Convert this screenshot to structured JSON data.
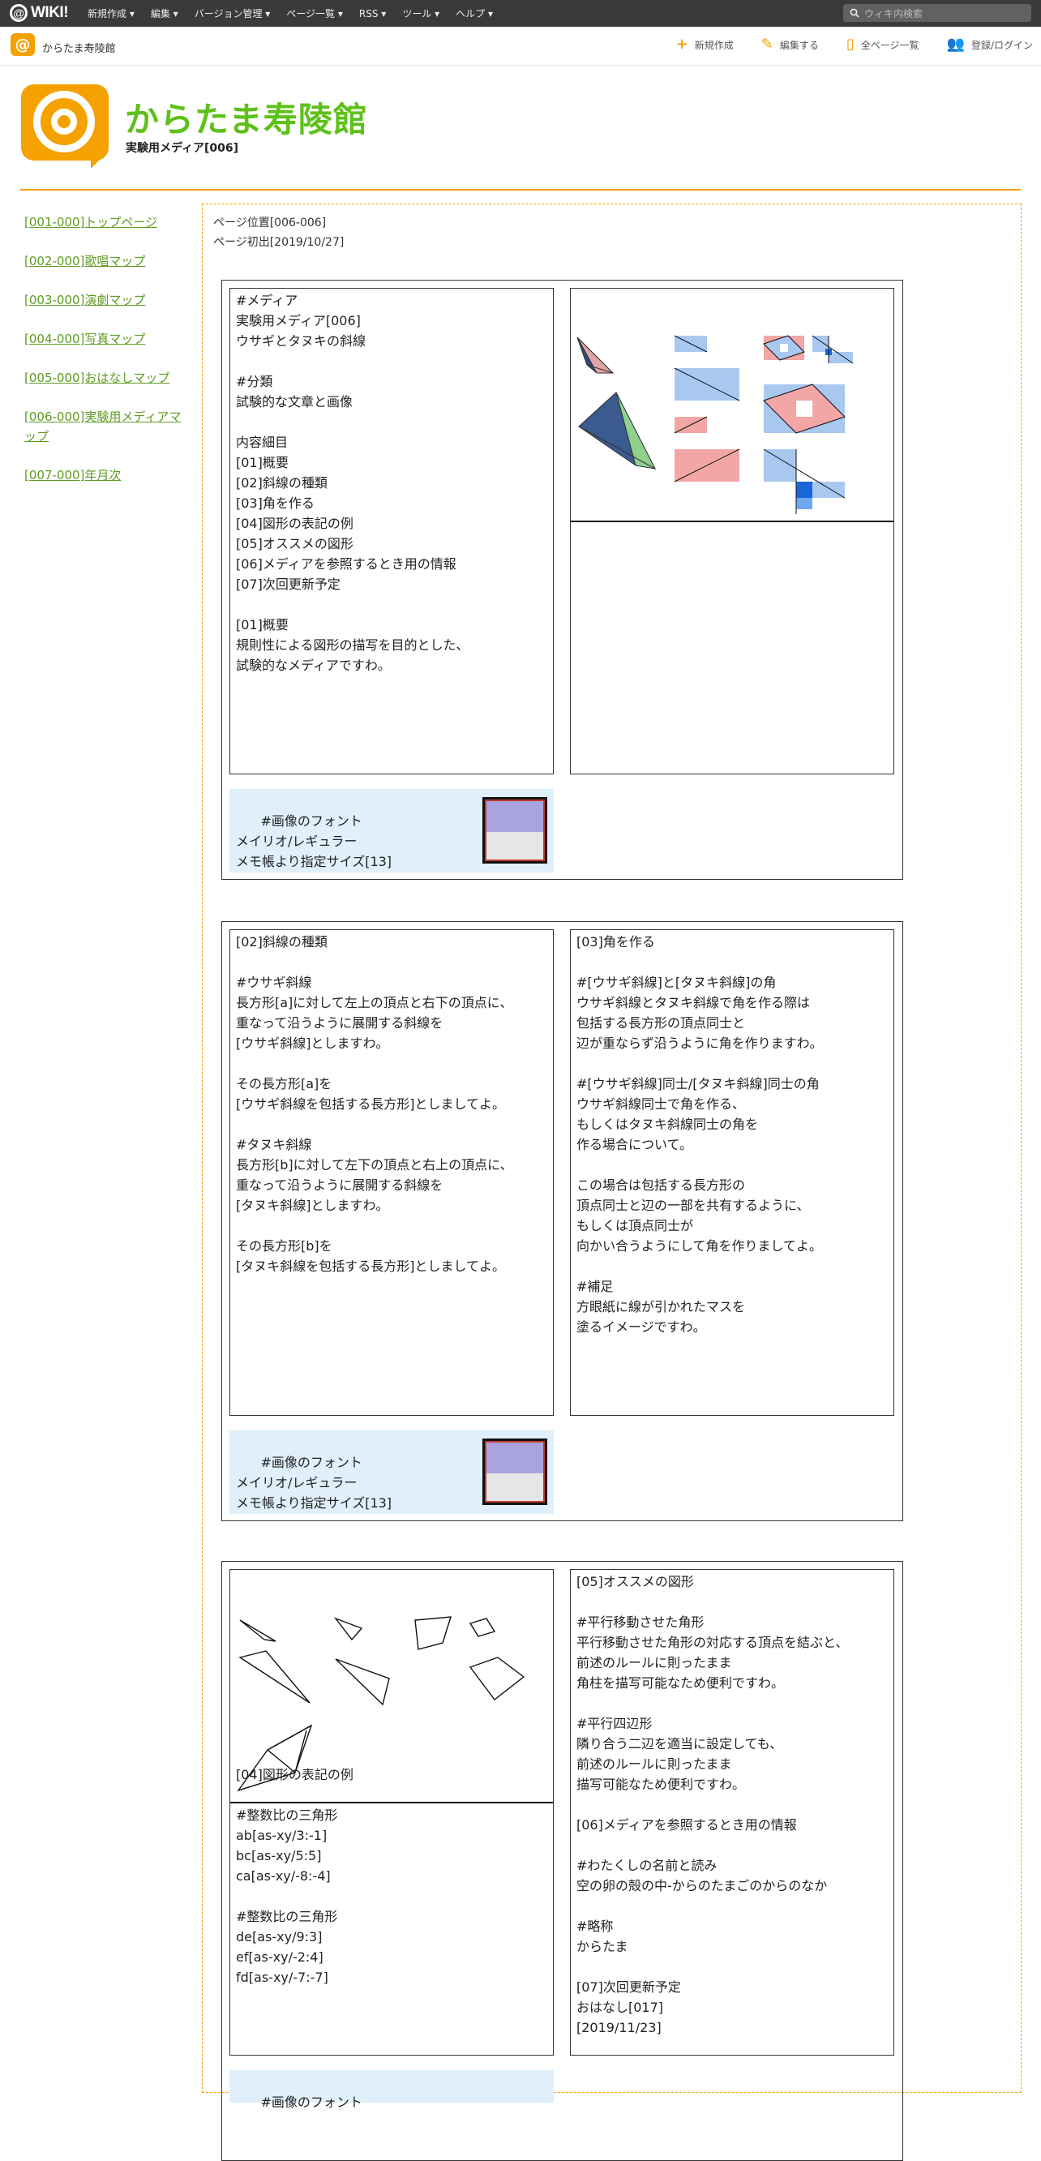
{
  "topbar": {
    "logo": "WIKI!",
    "menu": [
      "新規作成 ▾",
      "編集 ▾",
      "バージョン管理 ▾",
      "ページ一覧 ▾",
      "RSS ▾",
      "ツール ▾",
      "ヘルプ ▾"
    ],
    "search_placeholder": "ウィキ内検索"
  },
  "subbar": {
    "site_name": "からたま寿陵館",
    "actions": [
      "新規作成",
      "編集する",
      "全ページ一覧",
      "登録/ログイン"
    ]
  },
  "header": {
    "title": "からたま寿陵館",
    "subtitle": "実験用メディア[006]"
  },
  "sidebar": {
    "items": [
      "[001-000]トップページ",
      "[002-000]歌唱マップ",
      "[003-000]演劇マップ",
      "[004-000]写真マップ",
      "[005-000]おはなしマップ",
      "[006-000]実験用メディアマップ",
      "[007-000]年月次"
    ]
  },
  "main": {
    "page_position": "ページ位置[006-006]",
    "page_first": "ページ初出[2019/10/27]",
    "section1": {
      "text": "#メディア\n実験用メディア[006]\nウサギとタヌキの斜線\n\n#分類\n試験的な文章と画像\n\n内容細目\n[01]概要\n[02]斜線の種類\n[03]角を作る\n[04]図形の表記の例\n[05]オススメの図形\n[06]メディアを参照するとき用の情報\n[07]次回更新予定\n\n[01]概要\n規則性による図形の描写を目的とした、\n試験的なメディアですわ。",
      "font_info": "#画像のフォント\nメイリオ/レギュラー\nメモ帳より指定サイズ[13]"
    },
    "section2": {
      "left_text": "[02]斜線の種類\n\n#ウサギ斜線\n長方形[a]に対して左上の頂点と右下の頂点に、\n重なって沿うように展開する斜線を\n[ウサギ斜線]としますわ。\n\nその長方形[a]を\n[ウサギ斜線を包括する長方形]としましてよ。\n\n#タヌキ斜線\n長方形[b]に対して左下の頂点と右上の頂点に、\n重なって沿うように展開する斜線を\n[タヌキ斜線]としますわ。\n\nその長方形[b]を\n[タヌキ斜線を包括する長方形]としましてよ。",
      "right_text": "[03]角を作る\n\n#[ウサギ斜線]と[タヌキ斜線]の角\nウサギ斜線とタヌキ斜線で角を作る際は\n包括する長方形の頂点同士と\n辺が重ならず沿うように角を作りますわ。\n\n#[ウサギ斜線]同士/[タヌキ斜線]同士の角\nウサギ斜線同士で角を作る、\nもしくはタヌキ斜線同士の角を\n作る場合について。\n\nこの場合は包括する長方形の\n頂点同士と辺の一部を共有するように、\nもしくは頂点同士が\n向かい合うようにして角を作りましてよ。\n\n#補足\n方眼紙に線が引かれたマスを\n塗るイメージですわ。",
      "font_info": "#画像のフォント\nメイリオ/レギュラー\nメモ帳より指定サイズ[13]"
    },
    "section3": {
      "left_text": "[04]図形の表記の例\n\n#整数比の三角形\nab[as-xy/3:-1]\nbc[as-xy/5:5]\nca[as-xy/-8:-4]\n\n#整数比の三角形\nde[as-xy/9:3]\nef[as-xy/-2:4]\nfd[as-xy/-7:-7]",
      "right_text": "[05]オススメの図形\n\n#平行移動させた角形\n平行移動させた角形の対応する頂点を結ぶと、\n前述のルールに則ったまま\n角柱を描写可能なため便利ですわ。\n\n#平行四辺形\n隣り合う二辺を適当に設定しても、\n前述のルールに則ったまま\n描写可能なため便利ですわ。\n\n[06]メディアを参照するとき用の情報\n\n#わたくしの名前と読み\n空の卵の殻の中-からのたまごのからのなか\n\n#略称\nからたま\n\n[07]次回更新予定\nおはなし[017]\n[2019/11/23]",
      "font_heading": "#画像のフォント"
    }
  },
  "colors": {
    "accent": "#f5a100",
    "title_green": "#5ec11a",
    "link_green": "#5e9b22",
    "light_blue": "#dff0fb"
  }
}
